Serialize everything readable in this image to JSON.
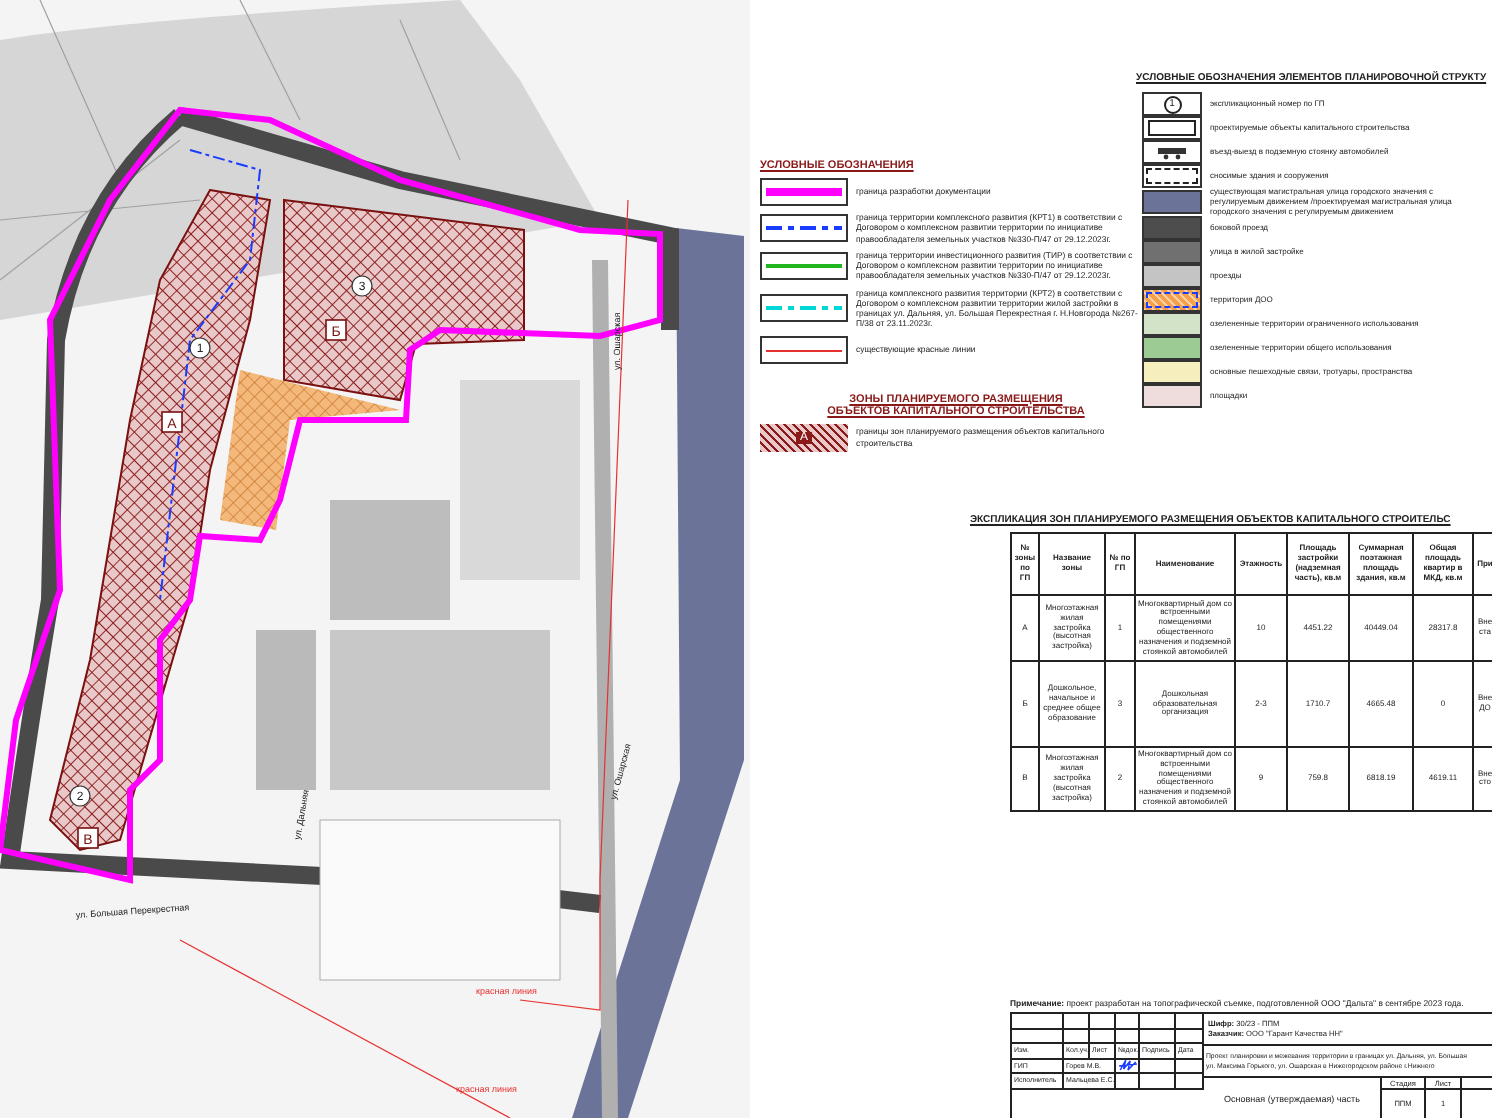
{
  "map": {
    "zones": [
      {
        "letter": "А",
        "number": "1"
      },
      {
        "letter": "Б",
        "number": "3"
      },
      {
        "letter": "В",
        "number": "2"
      }
    ],
    "street_labels": [
      {
        "text": "ул. Ошарская",
        "kind": "vertical"
      },
      {
        "text": "ул. Ошарская",
        "kind": "vertical"
      },
      {
        "text": "ул. Дальняя",
        "kind": "vertical"
      },
      {
        "text": "ул. Большая Перекрестная",
        "kind": "horizontal"
      },
      {
        "text": "красная линия",
        "kind": "red"
      },
      {
        "text": "красная линия",
        "kind": "red"
      }
    ]
  },
  "legend": {
    "title": "УСЛОВНЫЕ ОБОЗНАЧЕНИЯ",
    "items": [
      {
        "kind": "thick",
        "color": "#ff00ff",
        "label": "граница разработки документации"
      },
      {
        "kind": "dashdot",
        "color": "#1a3cff",
        "label": "граница территории комплексного развития (КРТ1) в соответствии с Договором о комплексном развитии территории по инициативе правообладателя земельных участков №330-П/47 от 29.12.2023г."
      },
      {
        "kind": "solid",
        "color": "#22b522",
        "label": "граница территории инвестиционного развития (ТИР) в соответствии с Договором о комплексном развитии территории по инициативе правообладателя земельных участков №330-П/47 от 29.12.2023г."
      },
      {
        "kind": "dashdot",
        "color": "#00d8d8",
        "label": "граница комплексного развития территории (КРТ2) в соответствии с Договором о комплексном развитии территории жилой застройки в границах ул. Дальняя, ул. Большая Перекрестная г. Н.Новгорода №267-П/38 от 23.11.2023г."
      },
      {
        "kind": "thin",
        "color": "#e83030",
        "label": "существующие красные линии"
      }
    ]
  },
  "zones_legend": {
    "title_lines": [
      "ЗОНЫ ПЛАНИРУЕМОГО РАЗМЕЩЕНИЯ",
      "ОБЪЕКТОВ КАПИТАЛЬНОГО СТРОИТЕЛЬСТВА"
    ],
    "letter": "А",
    "label": "границы зон планируемого размещения объектов капитального строительства"
  },
  "structure_legend": {
    "title": "УСЛОВНЫЕ ОБОЗНАЧЕНИЯ ЭЛЕМЕНТОВ ПЛАНИРОВОЧНОЙ СТРУКТУ",
    "items": [
      {
        "kind": "number",
        "symbol": "1",
        "label": "экспликационный номер по ГП"
      },
      {
        "kind": "outline",
        "label": "проектируемые объекты капитального строительства"
      },
      {
        "kind": "entrance",
        "label": "въезд-выезд в подземную стоянку автомобилей"
      },
      {
        "kind": "demolish",
        "label": "сносимые здания и сооружения"
      },
      {
        "kind": "fill",
        "color": "#6b7399",
        "label": "существующая магистральная улица городского значения с регулируемым движением /проектируемая магистральная улица городского значения с регулируемым движением"
      },
      {
        "kind": "fill",
        "color": "#4d4d4d",
        "label": "боковой проезд"
      },
      {
        "kind": "fill",
        "color": "#707070",
        "label": "улица в жилой застройке"
      },
      {
        "kind": "fill",
        "color": "#c4c4c4",
        "label": "проезды"
      },
      {
        "kind": "pattern",
        "color": "#f5a04a",
        "label": "территория ДОО"
      },
      {
        "kind": "fill",
        "color": "#d3e3c8",
        "label": "озелененные территории ограниченного использования"
      },
      {
        "kind": "fill",
        "color": "#9ccc94",
        "label": "озелененные территории общего использования"
      },
      {
        "kind": "fill",
        "color": "#f6efbd",
        "label": "основные пешеходные связи, тротуары, пространства"
      },
      {
        "kind": "fill",
        "color": "#efdcdc",
        "label": "площадки"
      }
    ]
  },
  "table": {
    "title": "ЭКСПЛИКАЦИЯ ЗОН ПЛАНИРУЕМОГО РАЗМЕЩЕНИЯ ОБЪЕКТОВ КАПИТАЛЬНОГО СТРОИТЕЛЬС",
    "columns": [
      "№ зоны по ГП",
      "Название зоны",
      "№ по ГП",
      "Наименование",
      "Этажность",
      "Площадь застройки (надземная часть), кв.м",
      "Суммарная поэтажная площадь здания, кв.м",
      "Общая площадь квартир в МКД, кв.м",
      "При"
    ],
    "rows": [
      [
        "А",
        "Многоэтажная жилая застройка (высотная застройка)",
        "1",
        "Многоквартирный дом со встроенными помещениями общественного назначения и подземной стоянкой автомобилей",
        "10",
        "4451.22",
        "40449.04",
        "28317.8",
        "Вне ста"
      ],
      [
        "Б",
        "Дошкольное, начальное и среднее общее образование",
        "3",
        "Дошкольная образовательная организация",
        "2-3",
        "1710.7",
        "4665.48",
        "0",
        "Вне ДО"
      ],
      [
        "В",
        "Многоэтажная жилая застройка (высотная застройка)",
        "2",
        "Многоквартирный дом со встроенными помещениями общественного назначения и подземной стоянкой автомобилей",
        "9",
        "759.8",
        "6818.19",
        "4619.11",
        "Вне сто"
      ]
    ]
  },
  "note": "**Примечание:** проект разработан на топографической съемке, подготовленной ООО \"Дальта\" в сентябре 2023 года.",
  "stamp": {
    "headers": [
      "Изм.",
      "Кол.уч.",
      "Лист",
      "№док.",
      "Подпись",
      "Дата"
    ],
    "people": [
      {
        "role": "ГИП",
        "name": "Горев М.В."
      },
      {
        "role": "Исполнитель",
        "name": "Мальцева Е.С."
      }
    ],
    "code": "**Шифр:** 30/23 - ППМ",
    "customer": "**Заказчик:** ООО \"Гарант Качества НН\"",
    "project": [
      "Проект планировки и межевания территории в границах ул. Дальняя, ул. Большая",
      "ул. Максима Горького, ул. Ошарская в Нижегородском районе г.Нижнего"
    ],
    "part": "Основная (утверждаемая) часть",
    "stage_headers": [
      "Стадия",
      "Лист"
    ],
    "stage_values": [
      "ППМ",
      "1"
    ]
  }
}
